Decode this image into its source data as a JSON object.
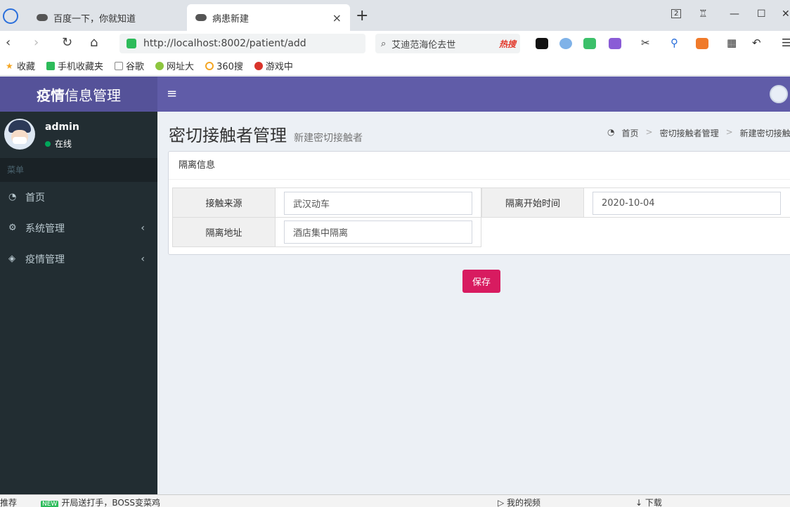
{
  "browser": {
    "tabs": [
      {
        "label": "百度一下，你就知道"
      },
      {
        "label": "病患新建",
        "close": "×"
      }
    ],
    "new_tab": "+",
    "tab_count": "2",
    "url": "http://localhost:8002/patient/add",
    "search_text": "艾迪范海伦去世",
    "hot_search": "热搜",
    "bookmarks": [
      "收藏",
      "手机收藏夹",
      "谷歌",
      "网址大",
      "360搜",
      "游戏中"
    ]
  },
  "app": {
    "logo_bold": "疫情",
    "logo_rest": "信息管理",
    "hamburger": "≡"
  },
  "sidebar": {
    "user_name": "admin",
    "user_status": "在线",
    "menu_header": "菜单",
    "items": [
      {
        "label": "首页"
      },
      {
        "label": "系统管理",
        "chevron": "‹"
      },
      {
        "label": "疫情管理",
        "chevron": "‹"
      }
    ]
  },
  "page": {
    "title": "密切接触者管理",
    "subtitle": "新建密切接触者",
    "breadcrumb": [
      "首页",
      "密切接触者管理",
      "新建密切接触者"
    ],
    "box_title": "隔离信息",
    "fields": {
      "source_label": "接触来源",
      "source_value": "武汉动车",
      "start_label": "隔离开始时间",
      "start_value": "2020-10-04",
      "address_label": "隔离地址",
      "address_value": "酒店集中隔离"
    },
    "save_label": "保存"
  },
  "statusbar": {
    "left": "推荐",
    "news": "开局送打手，BOSS变菜鸡",
    "new_badge": "NEW",
    "video": "我的视频",
    "download": "下载"
  }
}
